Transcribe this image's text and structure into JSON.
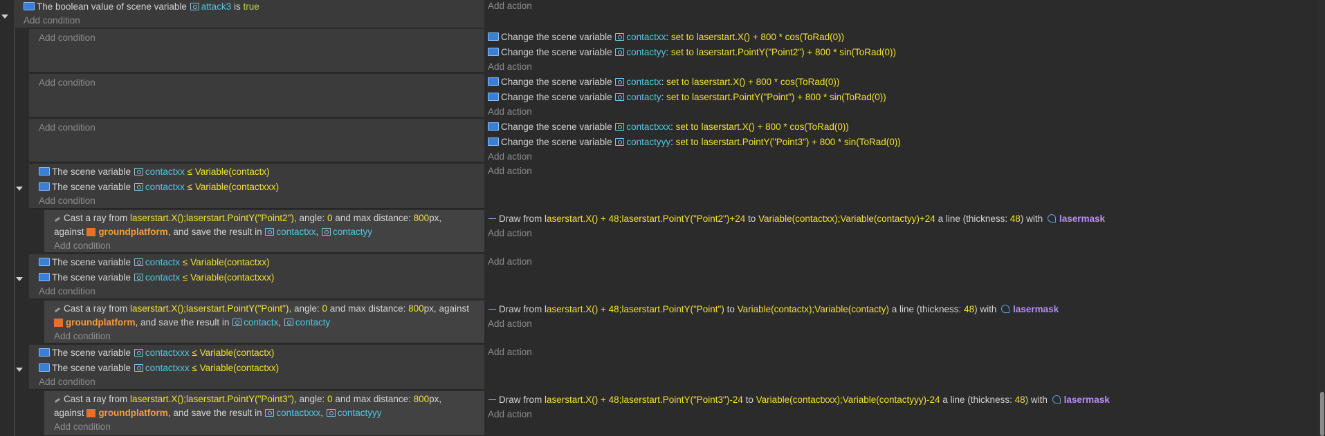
{
  "common": {
    "add_condition": "Add condition",
    "add_action": "Add action",
    "change_var": "Change the scene variable",
    "set_to": "set to",
    "the_scene_var": "The scene variable",
    "le": "≤",
    "cast_ray": "Cast a ray from",
    "angle_txt": ", angle:",
    "and_max": "and max distance:",
    "px": "px,",
    "against": "against",
    "save_result": ", and save the result in",
    "comma": ",",
    "draw_from": "Draw from",
    "to": "to",
    "a_line": "a line (thickness:",
    "with": ") with",
    "lasermask": "lasermask",
    "groundplatform": "groundplatform"
  },
  "event0": {
    "text": "The boolean value of scene variable",
    "var": "attack3",
    "is": "is",
    "value": "true"
  },
  "change_events": [
    {
      "a1": {
        "var": "contactxx",
        "expr": "laserstart.X() + 800 * cos(ToRad(0))"
      },
      "a2": {
        "var": "contactyy",
        "expr": "laserstart.PointY(\"Point2\") + 800 * sin(ToRad(0))"
      }
    },
    {
      "a1": {
        "var": "contactx",
        "expr": "laserstart.X() + 800 * cos(ToRad(0))"
      },
      "a2": {
        "var": "contacty",
        "expr": "laserstart.PointY(\"Point\") + 800 * sin(ToRad(0))"
      }
    },
    {
      "a1": {
        "var": "contactxxx",
        "expr": "laserstart.X() + 800 * cos(ToRad(0))"
      },
      "a2": {
        "var": "contactyyy",
        "expr": "laserstart.PointY(\"Point3\") + 800 * sin(ToRad(0))"
      }
    }
  ],
  "ray_groups": [
    {
      "c1": {
        "var": "contactxx",
        "cmp": "Variable(contactx)"
      },
      "c2": {
        "var": "contactxx",
        "cmp": "Variable(contactxxx)"
      },
      "ray": {
        "from": "laserstart.X();laserstart.PointY(\"Point2\")",
        "angle": "0",
        "dist": "800",
        "v1": "contactxx",
        "v2": "contactyy"
      },
      "draw": {
        "from": "laserstart.X() + 48;laserstart.PointY(\"Point2\")+24",
        "to": "Variable(contactxx);Variable(contactyy)+24",
        "thickness": "48"
      }
    },
    {
      "c1": {
        "var": "contactx",
        "cmp": "Variable(contactxx)"
      },
      "c2": {
        "var": "contactx",
        "cmp": "Variable(contactxxx)"
      },
      "ray": {
        "from": "laserstart.X();laserstart.PointY(\"Point\")",
        "angle": "0",
        "dist": "800",
        "v1": "contactx",
        "v2": "contacty"
      },
      "draw": {
        "from": "laserstart.X() + 48;laserstart.PointY(\"Point\")",
        "to": "Variable(contactx);Variable(contacty)",
        "thickness": "48"
      }
    },
    {
      "c1": {
        "var": "contactxxx",
        "cmp": "Variable(contactx)"
      },
      "c2": {
        "var": "contactxxx",
        "cmp": "Variable(contactxx)"
      },
      "ray": {
        "from": "laserstart.X();laserstart.PointY(\"Point3\")",
        "angle": "0",
        "dist": "800",
        "v1": "contactxxx",
        "v2": "contactyyy"
      },
      "draw": {
        "from": "laserstart.X() + 48;laserstart.PointY(\"Point3\")-24",
        "to": "Variable(contactxxx);Variable(contactyyy)-24",
        "thickness": "48"
      }
    }
  ]
}
